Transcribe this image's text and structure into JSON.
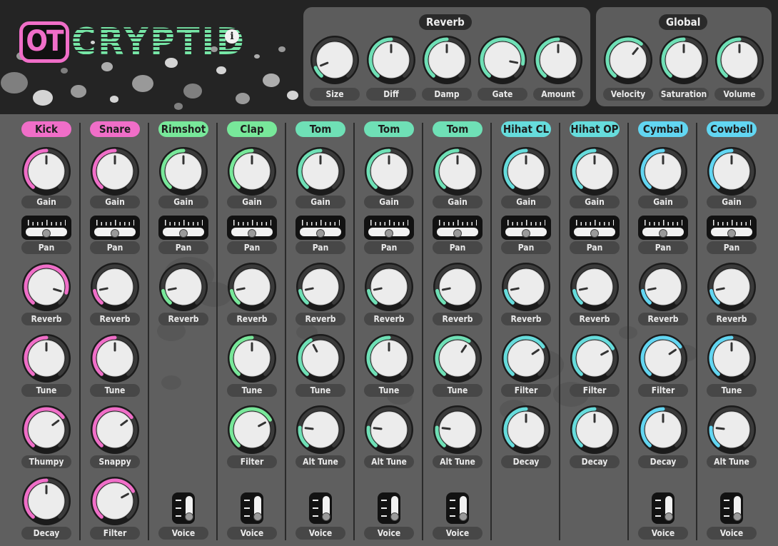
{
  "app": {
    "logo_badge": "OT",
    "logo_name": "CRYPTID",
    "info_glyph": "i"
  },
  "colors": {
    "pink": "#f06ec8",
    "green": "#78e89a",
    "teal": "#6fe0b6",
    "cyan": "#66dcdc",
    "blue": "#62d6f2"
  },
  "reverb_panel": {
    "title": "Reverb",
    "knobs": [
      {
        "label": "Size",
        "value": 0.1
      },
      {
        "label": "Diff",
        "value": 0.5
      },
      {
        "label": "Damp",
        "value": 0.5
      },
      {
        "label": "Gate",
        "value": 0.86
      },
      {
        "label": "Amount",
        "value": 0.5
      }
    ]
  },
  "global_panel": {
    "title": "Global",
    "knobs": [
      {
        "label": "Velocity",
        "value": 0.64
      },
      {
        "label": "Saturation",
        "value": 0.5
      },
      {
        "label": "Volume",
        "value": 0.5
      }
    ]
  },
  "channels": [
    {
      "name": "Kick",
      "color": "pink",
      "controls": [
        {
          "type": "knob",
          "label": "Gain",
          "value": 0.5
        },
        {
          "type": "pan",
          "label": "Pan",
          "value": 0.5
        },
        {
          "type": "knob",
          "label": "Reverb",
          "value": 0.88
        },
        {
          "type": "knob",
          "label": "Tune",
          "value": 0.5
        },
        {
          "type": "knob",
          "label": "Thumpy",
          "value": 0.69
        },
        {
          "type": "knob",
          "label": "Decay",
          "value": 0.5
        }
      ]
    },
    {
      "name": "Snare",
      "color": "pink",
      "controls": [
        {
          "type": "knob",
          "label": "Gain",
          "value": 0.5
        },
        {
          "type": "pan",
          "label": "Pan",
          "value": 0.5
        },
        {
          "type": "knob",
          "label": "Reverb",
          "value": 0.14
        },
        {
          "type": "knob",
          "label": "Tune",
          "value": 0.5
        },
        {
          "type": "knob",
          "label": "Snappy",
          "value": 0.69
        },
        {
          "type": "knob",
          "label": "Filter",
          "value": 0.72
        }
      ]
    },
    {
      "name": "Rimshot",
      "color": "green",
      "controls": [
        {
          "type": "knob",
          "label": "Gain",
          "value": 0.5
        },
        {
          "type": "pan",
          "label": "Pan",
          "value": 0.5
        },
        {
          "type": "knob",
          "label": "Reverb",
          "value": 0.14
        },
        {
          "type": "empty"
        },
        {
          "type": "empty"
        },
        {
          "type": "voice",
          "label": "Voice",
          "value": 1
        }
      ]
    },
    {
      "name": "Clap",
      "color": "green",
      "controls": [
        {
          "type": "knob",
          "label": "Gain",
          "value": 0.5
        },
        {
          "type": "pan",
          "label": "Pan",
          "value": 0.5
        },
        {
          "type": "knob",
          "label": "Reverb",
          "value": 0.14
        },
        {
          "type": "knob",
          "label": "Tune",
          "value": 0.5
        },
        {
          "type": "knob",
          "label": "Filter",
          "value": 0.72
        },
        {
          "type": "voice",
          "label": "Voice",
          "value": 1
        }
      ]
    },
    {
      "name": "Tom",
      "color": "teal",
      "controls": [
        {
          "type": "knob",
          "label": "Gain",
          "value": 0.5
        },
        {
          "type": "pan",
          "label": "Pan",
          "value": 0.5
        },
        {
          "type": "knob",
          "label": "Reverb",
          "value": 0.14
        },
        {
          "type": "knob",
          "label": "Tune",
          "value": 0.4
        },
        {
          "type": "knob",
          "label": "Alt Tune",
          "value": 0.2
        },
        {
          "type": "voice",
          "label": "Voice",
          "value": 1
        }
      ]
    },
    {
      "name": "Tom",
      "color": "teal",
      "controls": [
        {
          "type": "knob",
          "label": "Gain",
          "value": 0.5
        },
        {
          "type": "pan",
          "label": "Pan",
          "value": 0.5
        },
        {
          "type": "knob",
          "label": "Reverb",
          "value": 0.14
        },
        {
          "type": "knob",
          "label": "Tune",
          "value": 0.5
        },
        {
          "type": "knob",
          "label": "Alt Tune",
          "value": 0.2
        },
        {
          "type": "voice",
          "label": "Voice",
          "value": 1
        }
      ]
    },
    {
      "name": "Tom",
      "color": "teal",
      "controls": [
        {
          "type": "knob",
          "label": "Gain",
          "value": 0.5
        },
        {
          "type": "pan",
          "label": "Pan",
          "value": 0.5
        },
        {
          "type": "knob",
          "label": "Reverb",
          "value": 0.14
        },
        {
          "type": "knob",
          "label": "Tune",
          "value": 0.62
        },
        {
          "type": "knob",
          "label": "Alt Tune",
          "value": 0.2
        },
        {
          "type": "voice",
          "label": "Voice",
          "value": 1
        }
      ]
    },
    {
      "name": "Hihat CL",
      "color": "cyan",
      "controls": [
        {
          "type": "knob",
          "label": "Gain",
          "value": 0.5
        },
        {
          "type": "pan",
          "label": "Pan",
          "value": 0.5
        },
        {
          "type": "knob",
          "label": "Reverb",
          "value": 0.14
        },
        {
          "type": "knob",
          "label": "Filter",
          "value": 0.7
        },
        {
          "type": "knob",
          "label": "Decay",
          "value": 0.5
        },
        {
          "type": "empty"
        }
      ]
    },
    {
      "name": "Hihat OP",
      "color": "cyan",
      "controls": [
        {
          "type": "knob",
          "label": "Gain",
          "value": 0.5
        },
        {
          "type": "pan",
          "label": "Pan",
          "value": 0.5
        },
        {
          "type": "knob",
          "label": "Reverb",
          "value": 0.14
        },
        {
          "type": "knob",
          "label": "Filter",
          "value": 0.72
        },
        {
          "type": "knob",
          "label": "Decay",
          "value": 0.5
        },
        {
          "type": "empty"
        }
      ]
    },
    {
      "name": "Cymbal",
      "color": "blue",
      "controls": [
        {
          "type": "knob",
          "label": "Gain",
          "value": 0.5
        },
        {
          "type": "pan",
          "label": "Pan",
          "value": 0.5
        },
        {
          "type": "knob",
          "label": "Reverb",
          "value": 0.14
        },
        {
          "type": "knob",
          "label": "Filter",
          "value": 0.7
        },
        {
          "type": "knob",
          "label": "Decay",
          "value": 0.5
        },
        {
          "type": "voice",
          "label": "Voice",
          "value": 1
        }
      ]
    },
    {
      "name": "Cowbell",
      "color": "blue",
      "controls": [
        {
          "type": "knob",
          "label": "Gain",
          "value": 0.5
        },
        {
          "type": "pan",
          "label": "Pan",
          "value": 0.5
        },
        {
          "type": "knob",
          "label": "Reverb",
          "value": 0.14
        },
        {
          "type": "knob",
          "label": "Tune",
          "value": 0.5
        },
        {
          "type": "knob",
          "label": "Alt Tune",
          "value": 0.2
        },
        {
          "type": "voice",
          "label": "Voice",
          "value": 1
        }
      ]
    }
  ]
}
